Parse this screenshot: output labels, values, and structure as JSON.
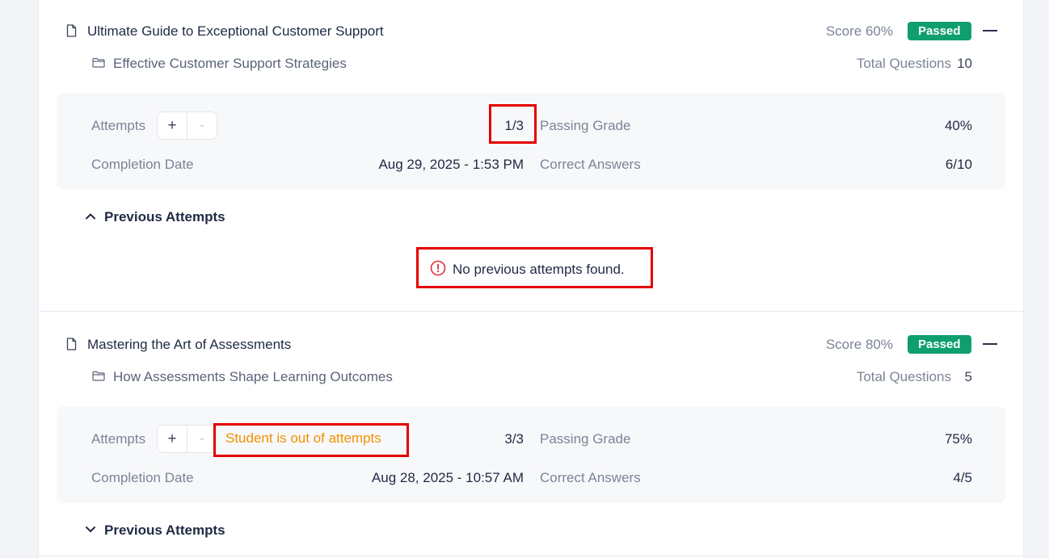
{
  "quizzes": [
    {
      "title": "Ultimate Guide to Exceptional Customer Support",
      "score_label": "Score 60%",
      "status": "Passed",
      "lesson": "Effective Customer Support Strategies",
      "total_questions_label": "Total Questions",
      "total_questions": "10",
      "attempts_label": "Attempts",
      "attempts_value": "1/3",
      "passing_grade_label": "Passing Grade",
      "passing_grade": "40%",
      "completion_date_label": "Completion Date",
      "completion_date": "Aug 29, 2025 - 1:53 PM",
      "correct_answers_label": "Correct Answers",
      "correct_answers": "6/10",
      "previous_attempts_label": "Previous Attempts",
      "previous_attempts_expanded": true,
      "no_attempts_message": "No previous attempts found."
    },
    {
      "title": "Mastering the Art of Assessments",
      "score_label": "Score 80%",
      "status": "Passed",
      "lesson": "How Assessments Shape Learning Outcomes",
      "total_questions_label": "Total Questions",
      "total_questions": "5",
      "attempts_label": "Attempts",
      "attempts_value": "3/3",
      "out_of_attempts_message": "Student is out of attempts",
      "passing_grade_label": "Passing Grade",
      "passing_grade": "75%",
      "completion_date_label": "Completion Date",
      "completion_date": "Aug 28, 2025 - 10:57 AM",
      "correct_answers_label": "Correct Answers",
      "correct_answers": "4/5",
      "previous_attempts_label": "Previous Attempts",
      "previous_attempts_expanded": false
    }
  ],
  "stepper": {
    "plus": "+",
    "minus": "-"
  },
  "icons": {
    "document": "document-icon",
    "folder": "folder-icon",
    "collapse": "minus-icon",
    "chevron_up": "chevron-up-icon",
    "chevron_down": "chevron-down-icon",
    "alert": "alert-circle-icon"
  },
  "colors": {
    "passed_badge": "#0f9f6e",
    "warning_text": "#f39200",
    "highlight_box": "#e30000",
    "alert_icon": "#e0303a"
  }
}
